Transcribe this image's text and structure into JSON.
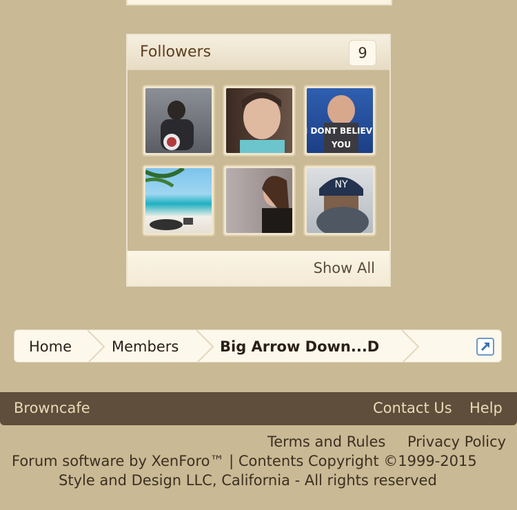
{
  "followers": {
    "title": "Followers",
    "count": "9",
    "show_all": "Show All",
    "avatars": [
      {
        "name": "follower-1"
      },
      {
        "name": "follower-2"
      },
      {
        "name": "follower-3",
        "caption_line1": "I DONT BELIEVE",
        "caption_line2": "YOU"
      },
      {
        "name": "follower-4"
      },
      {
        "name": "follower-5"
      },
      {
        "name": "follower-6"
      }
    ]
  },
  "breadcrumb": {
    "home": "Home",
    "members": "Members",
    "current": "Big Arrow Down...D"
  },
  "footer": {
    "site": "Browncafe",
    "contact": "Contact Us",
    "help": "Help",
    "terms": "Terms and Rules",
    "privacy": "Privacy Policy",
    "copyright_line1": "Forum software by XenForo™ | Contents Copyright ©1999-2015",
    "copyright_line2": "Style and Design LLC, California - All rights reserved"
  },
  "colors": {
    "background": "#c9b994",
    "footer_bar": "#5e4e3b",
    "footer_link": "#eadbb8",
    "title_brown": "#5e3d1e"
  },
  "icons": {
    "jump": "jump-menu-icon"
  }
}
